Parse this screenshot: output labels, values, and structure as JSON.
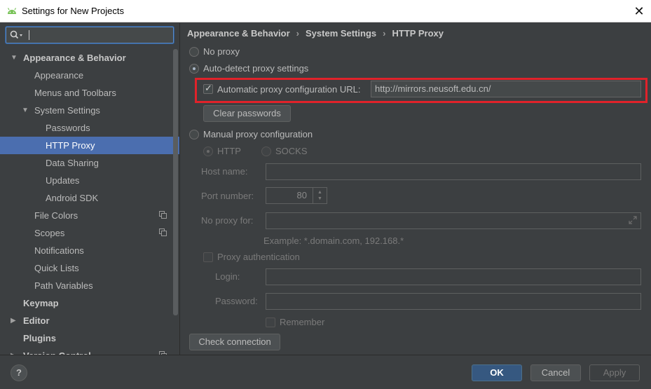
{
  "window": {
    "title": "Settings for New Projects"
  },
  "search": {
    "value": ""
  },
  "sidebar": {
    "items": [
      {
        "label": "Appearance & Behavior"
      },
      {
        "label": "Appearance"
      },
      {
        "label": "Menus and Toolbars"
      },
      {
        "label": "System Settings"
      },
      {
        "label": "Passwords"
      },
      {
        "label": "HTTP Proxy"
      },
      {
        "label": "Data Sharing"
      },
      {
        "label": "Updates"
      },
      {
        "label": "Android SDK"
      },
      {
        "label": "File Colors"
      },
      {
        "label": "Scopes"
      },
      {
        "label": "Notifications"
      },
      {
        "label": "Quick Lists"
      },
      {
        "label": "Path Variables"
      },
      {
        "label": "Keymap"
      },
      {
        "label": "Editor"
      },
      {
        "label": "Plugins"
      },
      {
        "label": "Version Control"
      }
    ]
  },
  "breadcrumb": {
    "part1": "Appearance & Behavior",
    "part2": "System Settings",
    "part3": "HTTP Proxy",
    "separator": "›"
  },
  "proxy": {
    "no_proxy_label": "No proxy",
    "auto_detect_label": "Auto-detect proxy settings",
    "auto_config_url_label": "Automatic proxy configuration URL:",
    "auto_config_url_value": "http://mirrors.neusoft.edu.cn/",
    "clear_passwords_label": "Clear passwords",
    "manual_label": "Manual proxy configuration",
    "http_label": "HTTP",
    "socks_label": "SOCKS",
    "host_name_label": "Host name:",
    "host_name_value": "",
    "port_number_label": "Port number:",
    "port_number_value": "80",
    "no_proxy_for_label": "No proxy for:",
    "no_proxy_for_value": "",
    "example_text": "Example: *.domain.com, 192.168.*",
    "proxy_auth_label": "Proxy authentication",
    "login_label": "Login:",
    "login_value": "",
    "password_label": "Password:",
    "password_value": "",
    "remember_label": "Remember",
    "check_connection_label": "Check connection"
  },
  "footer": {
    "help_label": "?",
    "ok_label": "OK",
    "cancel_label": "Cancel",
    "apply_label": "Apply"
  },
  "colors": {
    "selection": "#4b6eaf",
    "highlight_box": "#e0222a",
    "primary_button": "#365880",
    "background": "#3c3f41"
  }
}
